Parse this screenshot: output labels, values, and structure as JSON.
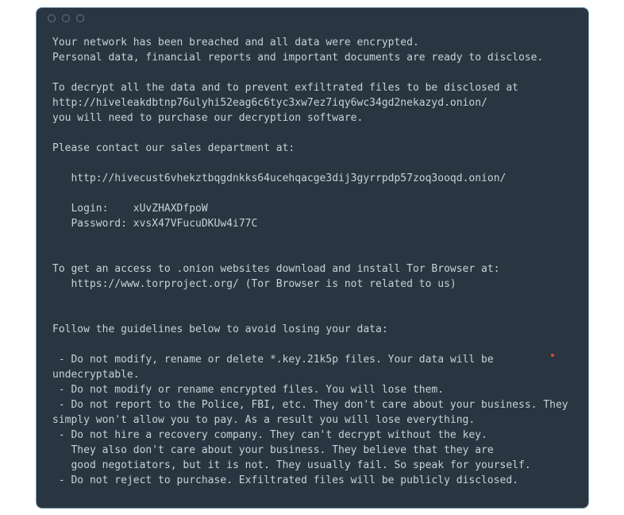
{
  "window": {
    "title": "",
    "traffic_light_count": 3
  },
  "note": {
    "intro_lines": [
      "Your network has been breached and all data were encrypted.",
      "Personal data, financial reports and important documents are ready to disclose."
    ],
    "decrypt_lines": [
      "To decrypt all the data and to prevent exfiltrated files to be disclosed at",
      "http://hiveleakdbtnp76ulyhi52eag6c6tyc3xw7ez7iqy6wc34gd2nekazyd.onion/",
      "you will need to purchase our decryption software."
    ],
    "contact_header": "Please contact our sales department at:",
    "contact_url": "http://hivecust6vhekztbqgdnkks64ucehqacge3dij3gyrrpdp57zoq3ooqd.onion/",
    "login_label": "Login:",
    "login_value": "xUvZHAXDfpoW",
    "password_label": "Password:",
    "password_value": "xvsX47VFucuDKUw4i77C",
    "tor_lines": [
      "To get an access to .onion websites download and install Tor Browser at:",
      "https://www.torproject.org/ (Tor Browser is not related to us)"
    ],
    "guidelines_header": "Follow the guidelines below to avoid losing your data:",
    "guidelines": [
      "Do not modify, rename or delete *.key.21k5p files. Your data will be undecryptable.",
      "Do not modify or rename encrypted files. You will lose them.",
      "Do not report to the Police, FBI, etc. They don't care about your business. They simply won't allow you to pay. As a result you will lose everything.",
      "Do not hire a recovery company. They can't decrypt without the key.\n   They also don't care about your business. They believe that they are\n   good negotiators, but it is not. They usually fail. So speak for yourself.",
      "Do not reject to purchase. Exfiltrated files will be publicly disclosed."
    ]
  }
}
